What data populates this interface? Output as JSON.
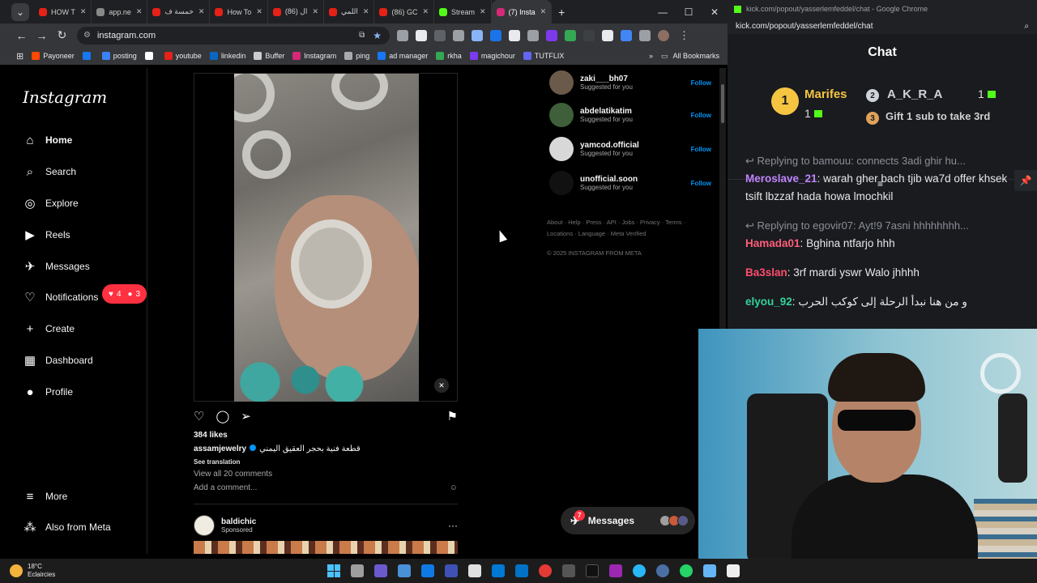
{
  "browser": {
    "tabs": [
      {
        "label": "HOW T",
        "color": "#e62117"
      },
      {
        "label": "app.ne",
        "color": "#888888"
      },
      {
        "label": "خمسة ف",
        "color": "#e62117"
      },
      {
        "label": "How To",
        "color": "#e62117"
      },
      {
        "label": "(86) ال",
        "color": "#e62117"
      },
      {
        "label": "اللمي",
        "color": "#e62117"
      },
      {
        "label": "(86) GC",
        "color": "#e62117"
      },
      {
        "label": "Stream",
        "color": "#53fc18"
      },
      {
        "label": "(7) Insta",
        "color": "#d62976",
        "active": true
      }
    ],
    "url": "instagram.com",
    "bookmarks": [
      {
        "label": "Payoneer",
        "color": "#ff4800"
      },
      {
        "label": "",
        "color": "#1877f2"
      },
      {
        "label": "posting",
        "color": "#3b82f6"
      },
      {
        "label": "",
        "color": "#ffffff"
      },
      {
        "label": "youtube",
        "color": "#e62117"
      },
      {
        "label": "linkedin",
        "color": "#0a66c2"
      },
      {
        "label": "Buffer",
        "color": "#cccccc"
      },
      {
        "label": "Instagram",
        "color": "#d62976"
      },
      {
        "label": "ping",
        "color": "#aaaaaa"
      },
      {
        "label": "ad manager",
        "color": "#1877f2"
      },
      {
        "label": "rkha",
        "color": "#34a853"
      },
      {
        "label": "magichour",
        "color": "#7c3aed"
      },
      {
        "label": "TUTFLIX",
        "color": "#6366f1"
      }
    ],
    "all_bookmarks": "All Bookmarks"
  },
  "instagram": {
    "logo": "Instagram",
    "nav": [
      {
        "label": "Home",
        "icon": "⌂",
        "active": true
      },
      {
        "label": "Search",
        "icon": "⌕"
      },
      {
        "label": "Explore",
        "icon": "◎"
      },
      {
        "label": "Reels",
        "icon": "▶"
      },
      {
        "label": "Messages",
        "icon": "✈",
        "badge": "7"
      },
      {
        "label": "Notifications",
        "icon": "♡"
      },
      {
        "label": "Create",
        "icon": "+"
      },
      {
        "label": "Dashboard",
        "icon": "▦"
      },
      {
        "label": "Profile",
        "icon": "●"
      }
    ],
    "notif_pill": {
      "likes": "4",
      "follows": "3"
    },
    "more": "More",
    "also_meta": "Also from Meta",
    "post": {
      "likes": "384 likes",
      "user": "assamjewelry",
      "caption": "قطعة فنية بحجر العقيق اليمني",
      "see_translation": "See translation",
      "view_comments": "View all 20 comments",
      "add_comment": "Add a comment..."
    },
    "post2": {
      "user": "baldichic",
      "sponsored": "Sponsored"
    },
    "suggestions": [
      {
        "name": "zaki___bh07",
        "sub": "Suggested for you",
        "follow": "Follow"
      },
      {
        "name": "abdelatikatim",
        "sub": "Suggested for you",
        "follow": "Follow"
      },
      {
        "name": "yamcod.official",
        "sub": "Suggested for you",
        "follow": "Follow"
      },
      {
        "name": "unofficial.soon",
        "sub": "Suggested for you",
        "follow": "Follow"
      }
    ],
    "footer_links_1": "About · Help · Press · API · Jobs · Privacy · Terms ·",
    "footer_links_2": "Locations · Language · Meta Verified",
    "copyright": "© 2025 INSTAGRAM FROM META",
    "messages_pill": {
      "label": "Messages",
      "badge": "7"
    }
  },
  "kick": {
    "window_title": "kick.com/popout/yasserlemfeddel/chat - Google Chrome",
    "url": "kick.com/popout/yasserlemfeddel/chat",
    "header": "Chat",
    "leaderboard": {
      "first": {
        "rank": "1",
        "name": "Marifes",
        "count": "1"
      },
      "second": {
        "rank": "2",
        "name": "A_K_R_A",
        "count": "1"
      },
      "third": {
        "rank": "3",
        "text": "Gift 1 sub to take 3rd"
      }
    },
    "messages": [
      {
        "reply": "Replying to bamouu: connects 3adi ghir hu...",
        "user": "Meroslave_21",
        "color": "#c084fc",
        "text": "warah gher bach tjib wa7d offer khsek tsift lbzzaf hada howa lmochkil"
      },
      {
        "reply": "Replying to egovir07: Ayt!9 7asni hhhhhhhh...",
        "user": "Hamada01",
        "color": "#ff5d7a",
        "text": "Bghina ntfarjo hhh"
      },
      {
        "user": "Ba3slan",
        "color": "#ff4d6d",
        "text": "3rf mardi yswr Walo jhhhh"
      },
      {
        "user": "elyou_92",
        "color": "#34d399",
        "text": "و من هنا نبدأ الرحلة إلى كوكب الحرب"
      }
    ]
  },
  "taskbar": {
    "temperature": "18°C",
    "weather": "Eclaircies"
  }
}
